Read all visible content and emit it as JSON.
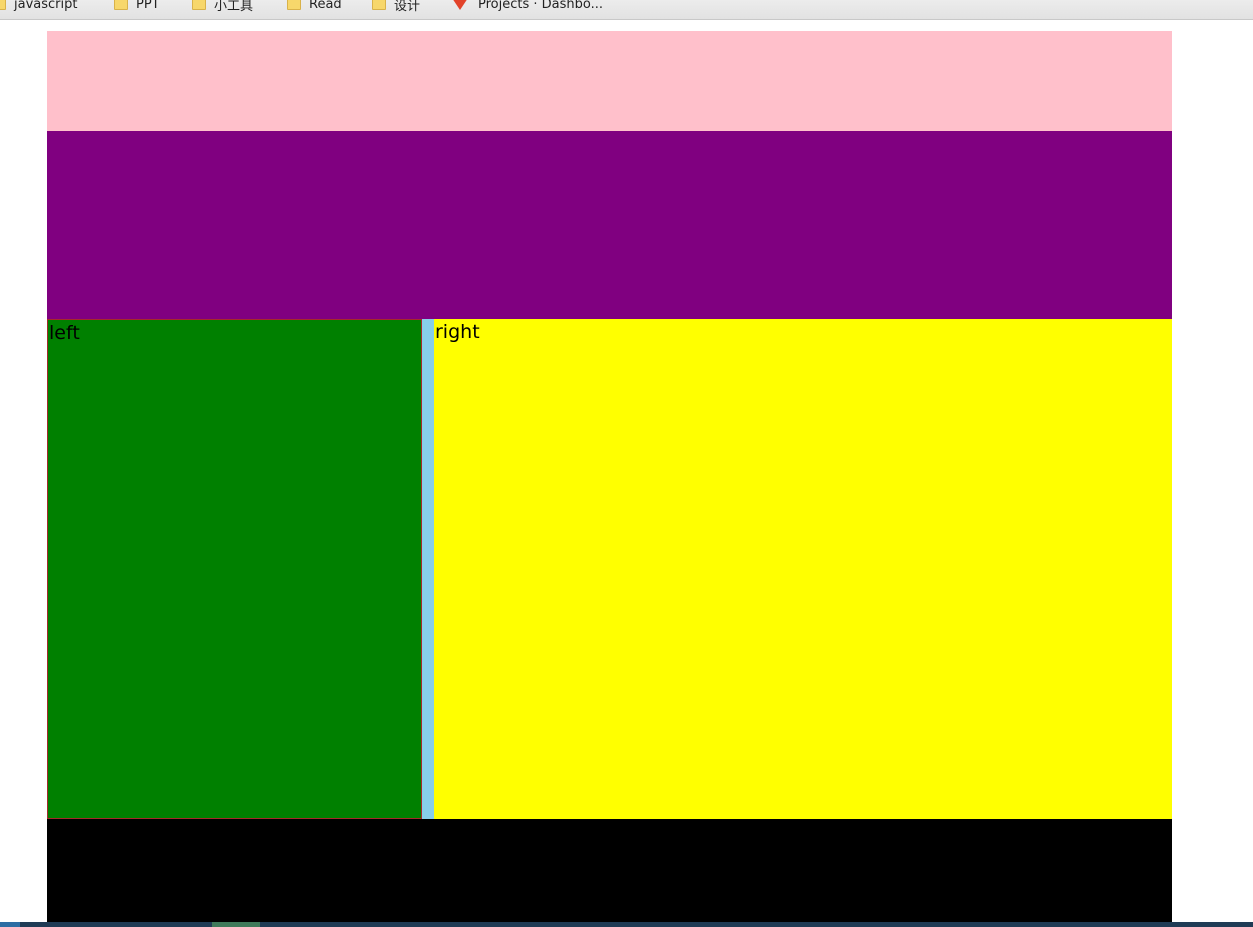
{
  "browser": {
    "bookmarks": [
      {
        "label": "javascript",
        "icon": "folder-icon"
      },
      {
        "label": "PPT",
        "icon": "folder-icon"
      },
      {
        "label": "小工具",
        "icon": "folder-icon"
      },
      {
        "label": "Read",
        "icon": "folder-icon"
      },
      {
        "label": "设计",
        "icon": "folder-icon"
      },
      {
        "label": "Projects · Dashbo...",
        "icon": "gitlab-icon"
      }
    ]
  },
  "layout": {
    "left_label": "left",
    "right_label": "right"
  },
  "colors": {
    "header": "#ffc0cb",
    "nav": "#800080",
    "left": "#008000",
    "left_border": "#a52a2a",
    "divider": "#87ceeb",
    "right": "#ffff00",
    "footer": "#000000"
  }
}
